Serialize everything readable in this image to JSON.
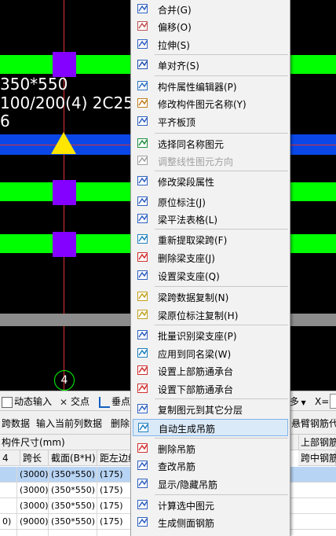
{
  "canvas": {
    "line1": "350*550",
    "line2": "100/200(4) 2C25",
    "line3": "6",
    "axis_label": "4",
    "colors": {
      "beam": "#00ff00",
      "column": "#8400ff",
      "band": "#0a47e6",
      "axis": "#e03030"
    }
  },
  "toolbar": {
    "dynamic_input": "动态输入",
    "intersection": "交点",
    "perpendicular": "垂点",
    "more_suffix": "多",
    "x_label": "X="
  },
  "gridbar": {
    "span_data": "跨数据",
    "input_prev_col": "输入当前列数据",
    "delete": "删除",
    "cantilever": "悬臂钢筋代号"
  },
  "table": {
    "header_top": {
      "member_size": "构件尺寸(mm)",
      "top_rebar": "上部钢筋"
    },
    "header_cols": [
      "4",
      "跨长",
      "截面(B*H)",
      "距左边线",
      "跨中钢筋"
    ],
    "rows": [
      {
        "c0": "",
        "c1": "(3000)",
        "c2": "(350*550)",
        "c3": "(175)",
        "selected": true
      },
      {
        "c0": "",
        "c1": "(3000)",
        "c2": "(350*550)",
        "c3": "(175)",
        "selected": false
      },
      {
        "c0": "",
        "c1": "(3000)",
        "c2": "(350*550)",
        "c3": "(175)",
        "selected": false
      },
      {
        "c0": "0)",
        "c1": "(9000)",
        "c2": "(350*550)",
        "c3": "(175)",
        "selected": false
      },
      {
        "c0": "",
        "c1": "",
        "c2": "",
        "c3": "",
        "selected": false
      }
    ]
  },
  "menu": {
    "items": [
      {
        "label": "合并(G)",
        "icon": "merge-icon"
      },
      {
        "label": "偏移(O)",
        "icon": "offset-icon"
      },
      {
        "label": "拉伸(S)",
        "icon": "stretch-icon"
      },
      {
        "label": "单对齐(S)",
        "icon": "align-icon"
      },
      {
        "label": "构件属性编辑器(P)",
        "icon": "property-editor-icon"
      },
      {
        "label": "修改构件图元名称(Y)",
        "icon": "rename-icon"
      },
      {
        "label": "平齐板顶",
        "icon": "flush-slab-icon"
      },
      {
        "label": "选择同名称图元",
        "icon": "select-same-name-icon"
      },
      {
        "label": "调整线性图元方向",
        "icon": "adjust-direction-icon",
        "disabled": true
      },
      {
        "label": "修改梁段属性",
        "icon": "beam-segment-icon"
      },
      {
        "label": "原位标注(J)",
        "icon": "in-situ-label-icon"
      },
      {
        "label": "梁平法表格(L)",
        "icon": "beam-table-icon"
      },
      {
        "label": "重新提取梁跨(F)",
        "icon": "extract-span-icon"
      },
      {
        "label": "删除梁支座(J)",
        "icon": "delete-support-icon"
      },
      {
        "label": "设置梁支座(Q)",
        "icon": "set-support-icon"
      },
      {
        "label": "梁跨数据复制(N)",
        "icon": "copy-span-icon"
      },
      {
        "label": "梁原位标注复制(H)",
        "icon": "copy-label-icon"
      },
      {
        "label": "批量识别梁支座(P)",
        "icon": "batch-identify-icon"
      },
      {
        "label": "应用到同名梁(W)",
        "icon": "apply-same-name-icon"
      },
      {
        "label": "设置上部筋通承台",
        "icon": "top-rebar-icon"
      },
      {
        "label": "设置下部筋通承台",
        "icon": "bottom-rebar-icon"
      },
      {
        "label": "复制图元到其它分层",
        "icon": "copy-layer-icon"
      },
      {
        "label": "自动生成吊筋",
        "icon": "auto-hanger-icon",
        "hover": true
      },
      {
        "label": "删除吊筋",
        "icon": "delete-hanger-icon"
      },
      {
        "label": "查改吊筋",
        "icon": "edit-hanger-icon"
      },
      {
        "label": "显示/隐藏吊筋",
        "icon": "toggle-hanger-icon"
      },
      {
        "label": "计算选中图元",
        "icon": "calculate-icon"
      },
      {
        "label": "生成侧面钢筋",
        "icon": "side-rebar-icon"
      }
    ]
  }
}
